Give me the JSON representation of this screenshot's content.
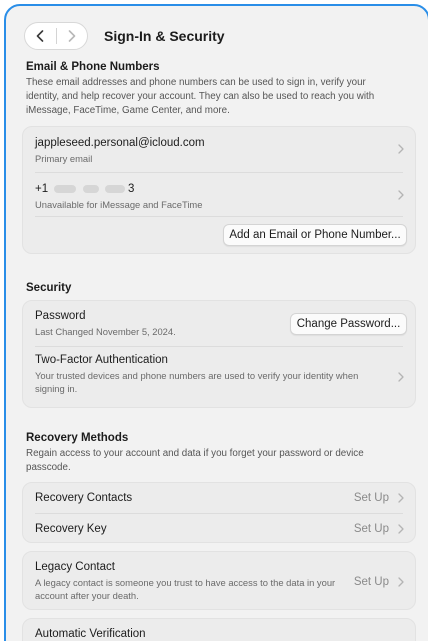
{
  "window": {
    "title": "Sign-In & Security"
  },
  "email_section": {
    "title": "Email & Phone Numbers",
    "description": "These email addresses and phone numbers can be used to sign in, verify your identity, and help recover your account. They can also be used to reach you with iMessage, FaceTime, Game Center, and more.",
    "items": [
      {
        "value": "jappleseed.personal@icloud.com",
        "caption": "Primary email"
      },
      {
        "value_prefix": "+1",
        "value_suffix": "3",
        "caption": "Unavailable for iMessage and FaceTime"
      }
    ],
    "add_button": "Add an Email or Phone Number..."
  },
  "security_section": {
    "title": "Security",
    "password": {
      "label": "Password",
      "caption": "Last Changed November 5, 2024.",
      "button": "Change Password..."
    },
    "two_factor": {
      "label": "Two-Factor Authentication",
      "caption": "Your trusted devices and phone numbers are used to verify your identity when signing in."
    }
  },
  "recovery_section": {
    "title": "Recovery Methods",
    "description": "Regain access to your account and data if you forget your password or device passcode.",
    "contacts": {
      "label": "Recovery Contacts",
      "action": "Set Up"
    },
    "key": {
      "label": "Recovery Key",
      "action": "Set Up"
    }
  },
  "legacy": {
    "label": "Legacy Contact",
    "caption": "A legacy contact is someone you trust to have access to the data in your account after your death.",
    "action": "Set Up"
  },
  "auto_verification": {
    "label": "Automatic Verification"
  },
  "colors": {
    "accent_border": "#2a8ee8",
    "background": "#f2f2f2",
    "group": "#ececec"
  }
}
